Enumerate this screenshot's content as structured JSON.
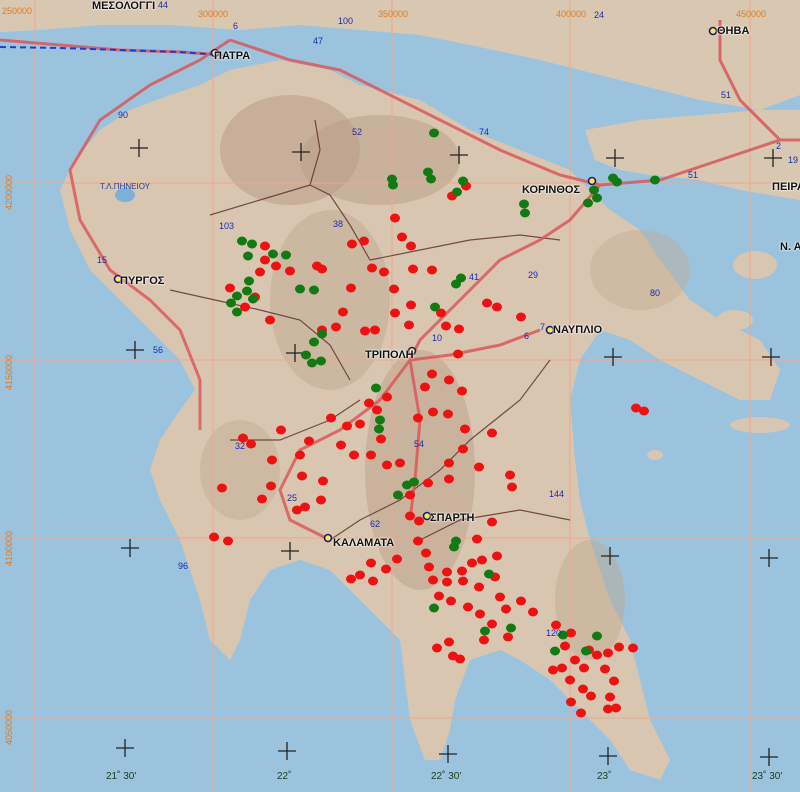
{
  "cities": [
    {
      "name": "ΜΕΣΟΛΟΓΓΙ"
    },
    {
      "name": "ΠΑΤΡΑ"
    },
    {
      "name": "ΚΟΡΙΝΘΟΣ"
    },
    {
      "name": "ΠΥΡΓΟΣ"
    },
    {
      "name": "ΤΡΙΠΟΛΗ"
    },
    {
      "name": "ΝΑΥΠΛΙΟ"
    },
    {
      "name": "ΚΑΛΑΜΑΤΑ"
    },
    {
      "name": "ΣΠΑΡΤΗ"
    },
    {
      "name": "ΘΗΒΑ"
    },
    {
      "name": "ΠΕΙΡΑ"
    },
    {
      "name": "Ν. Α"
    }
  ],
  "lake_label": "Τ.Λ.ΠΗΝΕΙΟΥ",
  "road_numbers": [
    "44",
    "100",
    "6",
    "47",
    "90",
    "74",
    "52",
    "51",
    "2",
    "19",
    "103",
    "38",
    "51",
    "15",
    "41",
    "29",
    "80",
    "56",
    "10",
    "6",
    "7",
    "32",
    "54",
    "144",
    "25",
    "62",
    "96",
    "120",
    "24"
  ],
  "grid_x_labels": [
    "250000",
    "300000",
    "350000",
    "400000",
    "450000"
  ],
  "grid_y_labels": [
    "4200000",
    "4150000",
    "4100000",
    "4050000"
  ],
  "degree_labels": [
    "21˚ 30'",
    "22˚",
    "22˚ 30'",
    "23˚",
    "23˚ 30'"
  ],
  "colors": {
    "sea": "#9cc3dd",
    "land": "#d9c7b4",
    "road": "#d9585a",
    "border": "#5b2a2a",
    "grid": "#f0a890",
    "point_red": "#ee1111",
    "point_green": "#127a12",
    "ferry": "#1a3fd0"
  }
}
